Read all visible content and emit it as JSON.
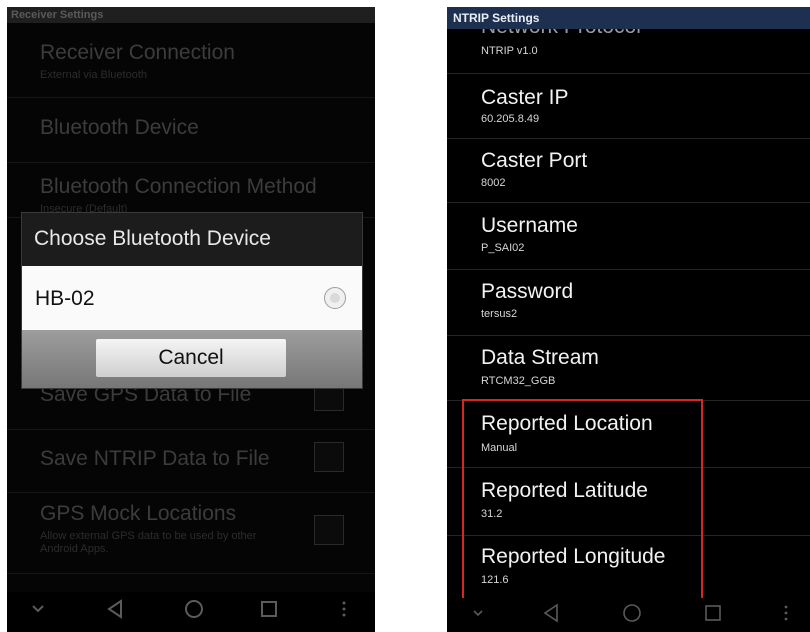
{
  "left": {
    "title_bar": "Receiver Settings",
    "items": [
      {
        "title": "Receiver Connection",
        "subtitle": "External via Bluetooth"
      },
      {
        "title": "Bluetooth Device",
        "subtitle": ""
      },
      {
        "title": "Bluetooth Connection Method",
        "subtitle": "Insecure (Default)"
      },
      {
        "title": "Save GPS Data to File",
        "subtitle": ""
      },
      {
        "title": "Save NTRIP Data to File",
        "subtitle": ""
      },
      {
        "title": "GPS Mock Locations",
        "subtitle": "Allow external GPS data to be used by other Android Apps."
      }
    ],
    "dialog": {
      "title": "Choose Bluetooth Device",
      "device": "HB-02",
      "cancel": "Cancel"
    }
  },
  "right": {
    "title_bar": "NTRIP Settings",
    "partial_item": {
      "title": "Network Protocol",
      "subtitle": "NTRIP v1.0"
    },
    "items": [
      {
        "title": "Caster IP",
        "subtitle": "60.205.8.49"
      },
      {
        "title": "Caster Port",
        "subtitle": "8002"
      },
      {
        "title": "Username",
        "subtitle": "P_SAI02"
      },
      {
        "title": "Password",
        "subtitle": "tersus2"
      },
      {
        "title": "Data Stream",
        "subtitle": "RTCM32_GGB"
      },
      {
        "title": "Reported Location",
        "subtitle": "Manual"
      },
      {
        "title": "Reported Latitude",
        "subtitle": "31.2"
      },
      {
        "title": "Reported Longitude",
        "subtitle": "121.6"
      }
    ]
  },
  "icons": {
    "nav": [
      "chevron-down-icon",
      "back-icon",
      "home-icon",
      "recents-icon",
      "more-vert-icon"
    ],
    "highlight_color": "#d6262a",
    "titlebar_color": "#1d3050"
  }
}
